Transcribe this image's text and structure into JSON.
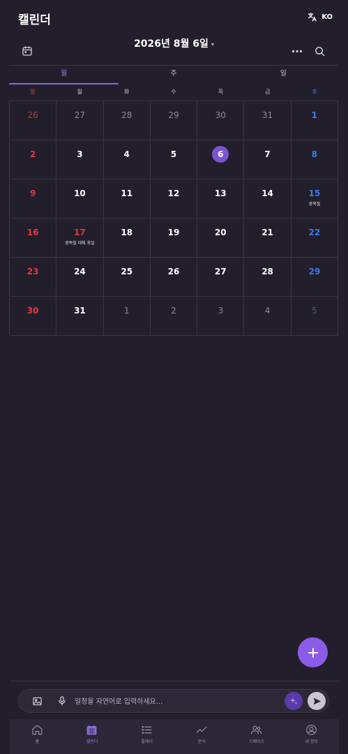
{
  "header": {
    "title": "캘린더",
    "lang_code": "KO"
  },
  "toolbar": {
    "date_title": "2026년 8월 6일",
    "caret": "▾"
  },
  "tabs": [
    {
      "label": "월",
      "active": true
    },
    {
      "label": "주",
      "active": false
    },
    {
      "label": "일",
      "active": false
    }
  ],
  "weekdays": [
    "일",
    "월",
    "화",
    "수",
    "목",
    "금",
    "토"
  ],
  "calendar": {
    "weeks": [
      [
        {
          "d": "26",
          "other": true
        },
        {
          "d": "27",
          "other": true
        },
        {
          "d": "28",
          "other": true
        },
        {
          "d": "29",
          "other": true
        },
        {
          "d": "30",
          "other": true
        },
        {
          "d": "31",
          "other": true
        },
        {
          "d": "1"
        }
      ],
      [
        {
          "d": "2"
        },
        {
          "d": "3"
        },
        {
          "d": "4"
        },
        {
          "d": "5"
        },
        {
          "d": "6",
          "today": true
        },
        {
          "d": "7"
        },
        {
          "d": "8"
        }
      ],
      [
        {
          "d": "9"
        },
        {
          "d": "10"
        },
        {
          "d": "11"
        },
        {
          "d": "12"
        },
        {
          "d": "13"
        },
        {
          "d": "14"
        },
        {
          "d": "15",
          "event": "광복절"
        }
      ],
      [
        {
          "d": "16"
        },
        {
          "d": "17",
          "holiday": true,
          "event": "광복절 대체 휴일"
        },
        {
          "d": "18"
        },
        {
          "d": "19"
        },
        {
          "d": "20"
        },
        {
          "d": "21"
        },
        {
          "d": "22"
        }
      ],
      [
        {
          "d": "23"
        },
        {
          "d": "24"
        },
        {
          "d": "25"
        },
        {
          "d": "26"
        },
        {
          "d": "27"
        },
        {
          "d": "28"
        },
        {
          "d": "29"
        }
      ],
      [
        {
          "d": "30"
        },
        {
          "d": "31"
        },
        {
          "d": "1",
          "other": true
        },
        {
          "d": "2",
          "other": true
        },
        {
          "d": "3",
          "other": true
        },
        {
          "d": "4",
          "other": true
        },
        {
          "d": "5",
          "other": true
        }
      ]
    ]
  },
  "input": {
    "placeholder": "일정을 자연어로 입력하세요..."
  },
  "nav": [
    {
      "label": "홈",
      "icon": "home-icon",
      "active": false
    },
    {
      "label": "캘린더",
      "icon": "calendar-icon",
      "active": true
    },
    {
      "label": "플래너",
      "icon": "list-icon",
      "active": false
    },
    {
      "label": "분석",
      "icon": "trend-icon",
      "active": false
    },
    {
      "label": "스페이스",
      "icon": "people-icon",
      "active": false
    },
    {
      "label": "내 정보",
      "icon": "profile-icon",
      "active": false
    }
  ],
  "colors": {
    "background": "#221e2b",
    "accent": "#8c5ce9",
    "sunday": "#e33b3b",
    "saturday": "#3f7be8",
    "today": "#7a55cf"
  }
}
